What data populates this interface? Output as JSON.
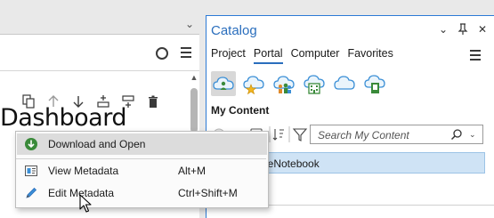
{
  "left_pane": {
    "heading": "Dashboard"
  },
  "context_menu": {
    "items": [
      {
        "label": "Download and Open",
        "shortcut": ""
      },
      {
        "label": "View Metadata",
        "shortcut": "Alt+M"
      },
      {
        "label": "Edit Metadata",
        "shortcut": "Ctrl+Shift+M"
      }
    ]
  },
  "catalog": {
    "title": "Catalog",
    "tabs": [
      "Project",
      "Portal",
      "Computer",
      "Favorites"
    ],
    "active_tab": "Portal",
    "section_label": "My Content",
    "search_placeholder": "Search My Content",
    "result_item": "leNotebook"
  },
  "colors": {
    "accent": "#2a6ebd",
    "selection": "#cfe3f5",
    "download_icon": "#3a8a3a"
  }
}
